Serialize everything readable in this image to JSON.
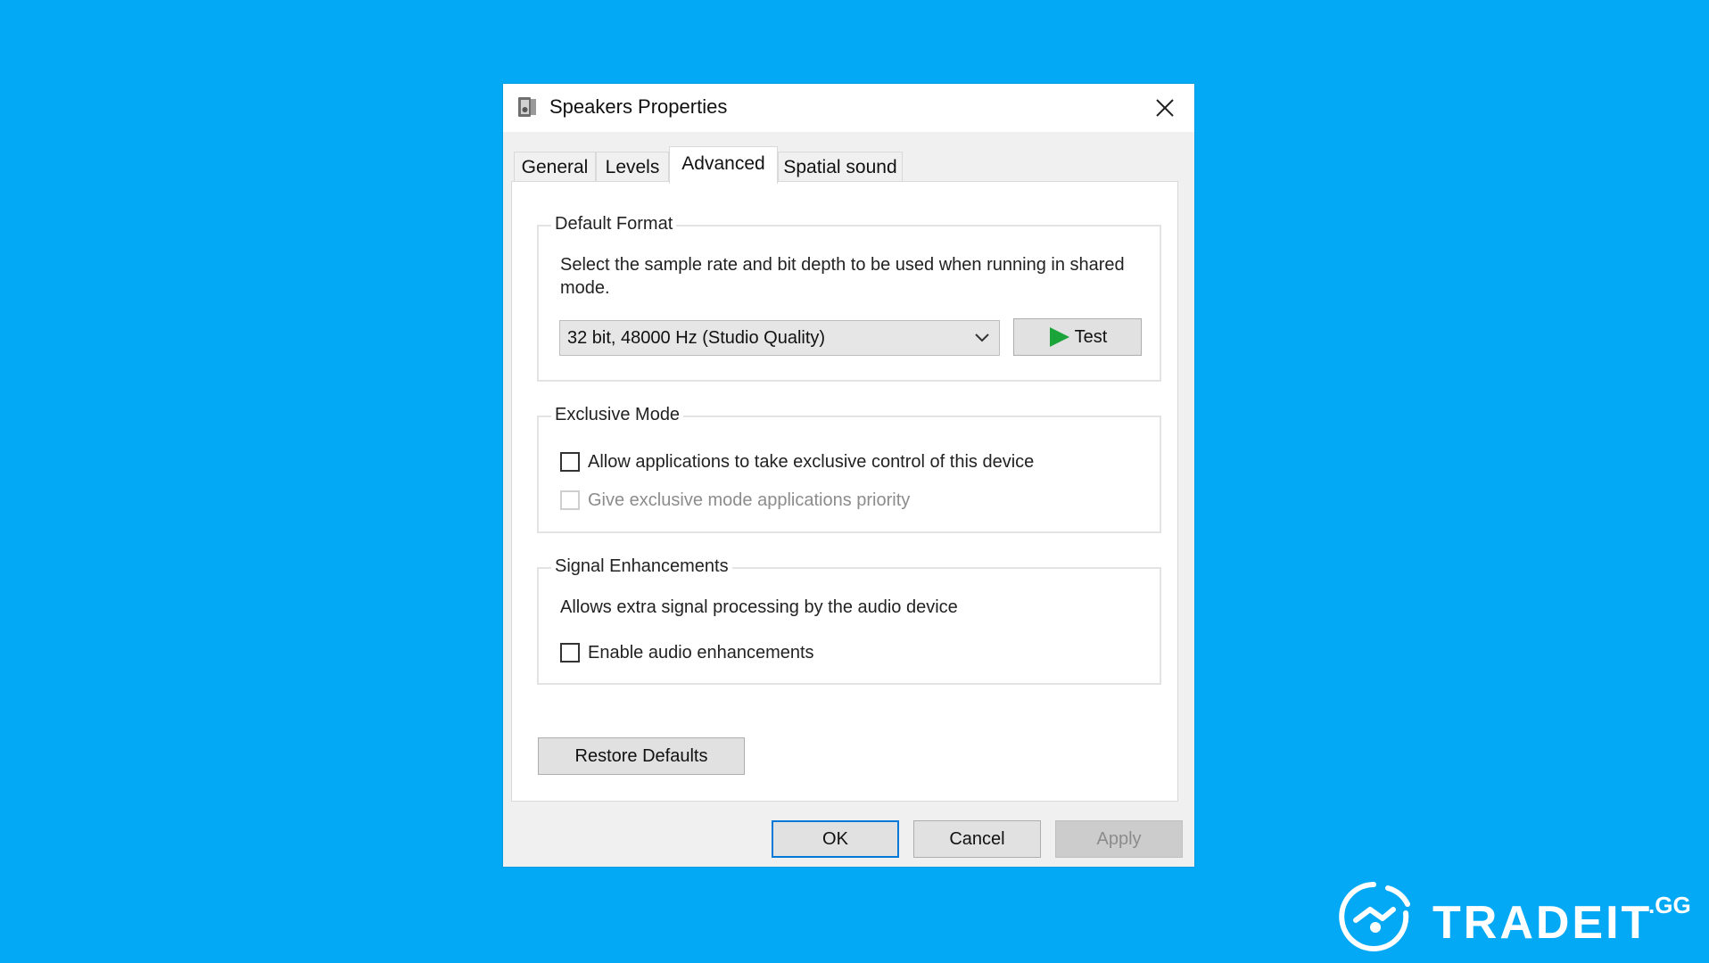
{
  "dialog": {
    "title": "Speakers Properties",
    "close_icon": "close-icon",
    "title_icon": "speaker-icon"
  },
  "tabs": [
    {
      "label": "General",
      "active": false
    },
    {
      "label": "Levels",
      "active": false
    },
    {
      "label": "Advanced",
      "active": true
    },
    {
      "label": "Spatial sound",
      "active": false
    }
  ],
  "default_format": {
    "legend": "Default Format",
    "description": "Select the sample rate and bit depth to be used when running in shared mode.",
    "selected_format": "32 bit, 48000 Hz (Studio Quality)",
    "test_label": "Test"
  },
  "exclusive_mode": {
    "legend": "Exclusive Mode",
    "allow_exclusive_label": "Allow applications to take exclusive control of this device",
    "allow_exclusive_checked": false,
    "priority_label": "Give exclusive mode applications priority",
    "priority_checked": false,
    "priority_enabled": false
  },
  "signal_enhancements": {
    "legend": "Signal Enhancements",
    "description": "Allows extra signal processing by the audio device",
    "enable_label": "Enable audio enhancements",
    "enable_checked": false
  },
  "restore_defaults_label": "Restore Defaults",
  "footer": {
    "ok_label": "OK",
    "cancel_label": "Cancel",
    "apply_label": "Apply"
  },
  "colors": {
    "background": "#03a9f4",
    "play_icon": "#1aa43a",
    "focus_border": "#0078d7"
  },
  "branding": {
    "logo_text": "TRADEIT",
    "logo_suffix": ".GG"
  }
}
